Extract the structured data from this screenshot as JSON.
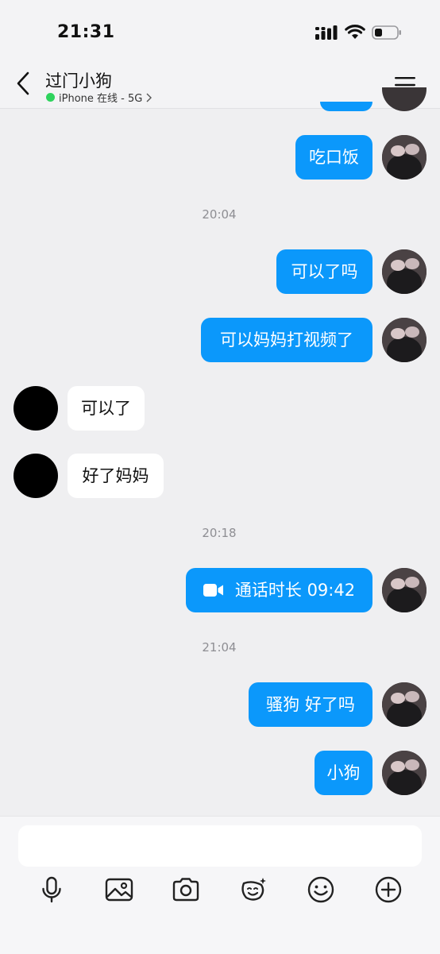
{
  "status_bar": {
    "time": "21:31"
  },
  "header": {
    "contact_name": "过门小狗",
    "presence": "iPhone 在线 - 5G"
  },
  "messages": [
    {
      "from": "me",
      "text": "吃口饭"
    },
    {
      "type": "time",
      "text": "20:04"
    },
    {
      "from": "me",
      "text": "可以了吗"
    },
    {
      "from": "me",
      "text": "可以妈妈打视频了"
    },
    {
      "from": "other",
      "text": "可以了"
    },
    {
      "from": "other",
      "text": "好了妈妈"
    },
    {
      "type": "time",
      "text": "20:18"
    },
    {
      "from": "me",
      "type": "call",
      "text": "通话时长 09:42"
    },
    {
      "type": "time",
      "text": "21:04"
    },
    {
      "from": "me",
      "text": "骚狗 好了吗"
    },
    {
      "from": "me",
      "text": "小狗"
    }
  ],
  "input": {
    "placeholder": ""
  },
  "toolbar": [
    "microphone-icon",
    "image-icon",
    "camera-icon",
    "sticker-icon",
    "emoji-icon",
    "plus-icon"
  ],
  "colors": {
    "outgoing_bubble": "#0b98fb",
    "incoming_bubble": "#ffffff",
    "online_dot": "#2ed35d",
    "background": "#efeff1"
  }
}
